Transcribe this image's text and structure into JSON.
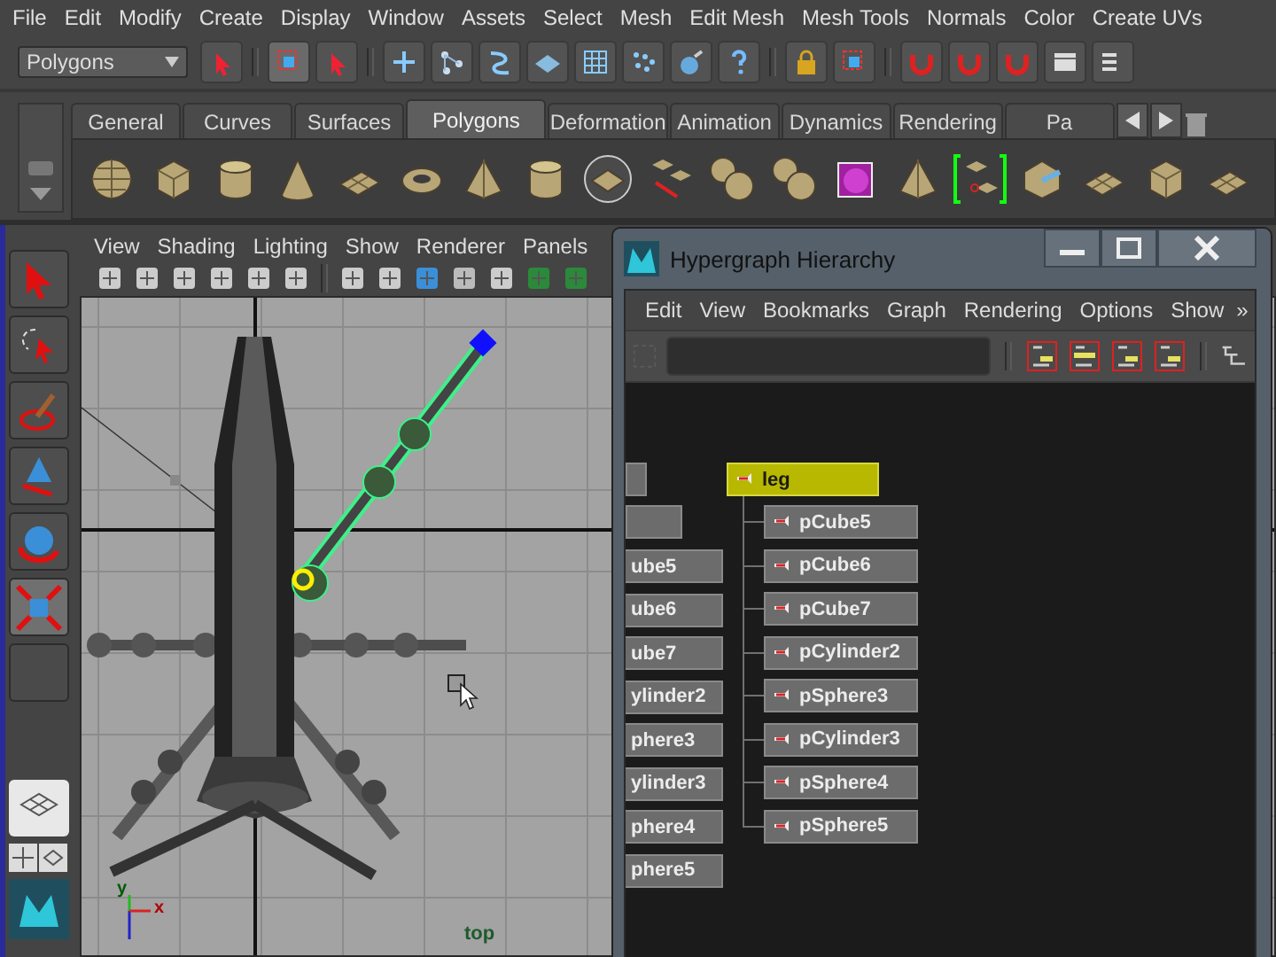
{
  "menu_bar": [
    "File",
    "Edit",
    "Modify",
    "Create",
    "Display",
    "Window",
    "Assets",
    "Select",
    "Mesh",
    "Edit Mesh",
    "Mesh Tools",
    "Normals",
    "Color",
    "Create UVs"
  ],
  "status_line": {
    "mode": "Polygons"
  },
  "shelf": {
    "tabs": [
      {
        "label": "General",
        "selected": false
      },
      {
        "label": "Curves",
        "selected": false
      },
      {
        "label": "Surfaces",
        "selected": false
      },
      {
        "label": "Polygons",
        "selected": true
      },
      {
        "label": "Deformation",
        "selected": false
      },
      {
        "label": "Animation",
        "selected": false
      },
      {
        "label": "Dynamics",
        "selected": false
      },
      {
        "label": "Rendering",
        "selected": false
      },
      {
        "label": "Pa",
        "selected": false
      }
    ]
  },
  "toolbox": {
    "tools": [
      {
        "kind": "select",
        "selected": false
      },
      {
        "kind": "lasso",
        "selected": false
      },
      {
        "kind": "paint",
        "selected": false
      },
      {
        "kind": "move",
        "selected": false
      },
      {
        "kind": "rotate",
        "selected": false
      },
      {
        "kind": "scale",
        "selected": true
      }
    ]
  },
  "viewport": {
    "menu": [
      "View",
      "Shading",
      "Lighting",
      "Show",
      "Renderer",
      "Panels"
    ],
    "axis_x": "x",
    "axis_y": "y",
    "camera": "top"
  },
  "hypergraph": {
    "title": "Hypergraph Hierarchy",
    "menu": [
      "Edit",
      "View",
      "Bookmarks",
      "Graph",
      "Rendering",
      "Options",
      "Show"
    ],
    "overflow": "»",
    "left_nodes": [
      "ube5",
      "ube6",
      "ube7",
      "ylinder2",
      "phere3",
      "ylinder3",
      "phere4",
      "phere5"
    ],
    "tree": {
      "label": "leg",
      "selected": true,
      "children": [
        {
          "label": "pCube5",
          "selected": false
        },
        {
          "label": "pCube6",
          "selected": false
        },
        {
          "label": "pCube7",
          "selected": false
        },
        {
          "label": "pCylinder2",
          "selected": false
        },
        {
          "label": "pSphere3",
          "selected": false
        },
        {
          "label": "pCylinder3",
          "selected": false
        },
        {
          "label": "pSphere4",
          "selected": false
        },
        {
          "label": "pSphere5",
          "selected": false
        }
      ]
    }
  }
}
